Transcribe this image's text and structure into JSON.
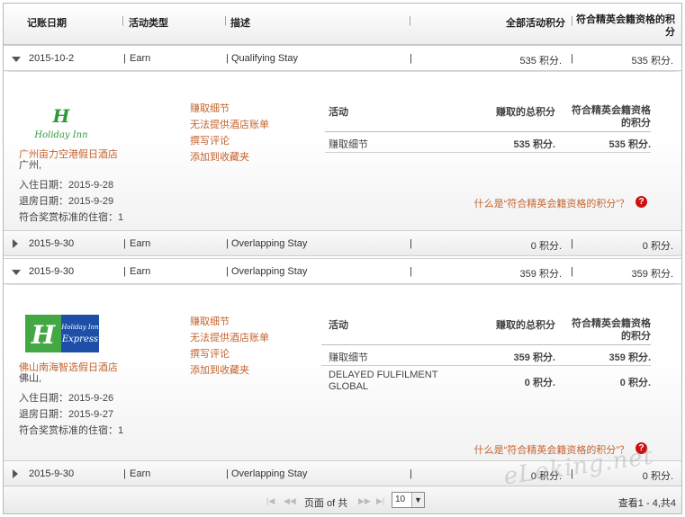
{
  "header": {
    "col_date": "记账日期",
    "col_type": "活动类型",
    "col_desc": "描述",
    "col_total": "全部活动积分",
    "col_elite_1": "符合精英会籍资格的积",
    "col_elite_2": "分"
  },
  "rows": [
    {
      "date": "2015-10-2",
      "type": "Earn",
      "desc": "Qualifying Stay",
      "total": "535 积分.",
      "elite": "535 积分."
    },
    {
      "date": "2015-9-30",
      "type": "Earn",
      "desc": "Overlapping Stay",
      "total": "0 积分.",
      "elite": "0 积分."
    },
    {
      "date": "2015-9-30",
      "type": "Earn",
      "desc": "Overlapping Stay",
      "total": "359 积分.",
      "elite": "359 积分."
    },
    {
      "date": "2015-9-30",
      "type": "Earn",
      "desc": "Overlapping Stay",
      "total": "0 积分.",
      "elite": "0 积分."
    }
  ],
  "details": [
    {
      "logo_line1": "Holiday Inn",
      "hotel_name": "广州亩力空港假日酒店",
      "city": "广州,",
      "checkin": "入住日期：2015-9-28",
      "checkout": "退房日期：2015-9-29",
      "nights": "符合奖赏标准的住宿：1",
      "links": [
        "赚取细节",
        "无法提供酒店账单",
        "撰写评论",
        "添加到收藏夹"
      ],
      "table_head": {
        "activity": "活动",
        "earned": "赚取的总积分",
        "elite_1": "符合精英会籍资格",
        "elite_2": "的积分"
      },
      "table_rows": [
        {
          "activity": "赚取细节",
          "activity_2": "",
          "earned": "535 积分.",
          "elite": "535 积分."
        }
      ],
      "question": "什么是“符合精英会籍资格的积分”？"
    },
    {
      "logo_line1": "Holiday Inn",
      "logo_line2": "Express",
      "hotel_name": "佛山南海智选假日酒店",
      "city": "佛山,",
      "checkin": "入住日期：2015-9-26",
      "checkout": "退房日期：2015-9-27",
      "nights": "符合奖赏标准的住宿：1",
      "links": [
        "赚取细节",
        "无法提供酒店账单",
        "撰写评论",
        "添加到收藏夹"
      ],
      "table_head": {
        "activity": "活动",
        "earned": "赚取的总积分",
        "elite_1": "符合精英会籍资格",
        "elite_2": "的积分"
      },
      "table_rows": [
        {
          "activity": "赚取细节",
          "activity_2": "",
          "earned": "359 积分.",
          "elite": "359 积分."
        },
        {
          "activity": "DELAYED FULFILMENT",
          "activity_2": "GLOBAL",
          "earned": "0 积分.",
          "elite": "0 积分."
        }
      ],
      "question": "什么是“符合精英会籍资格的积分”？"
    }
  ],
  "pager": {
    "page_label": "页面 of 共",
    "page_size": "10",
    "summary": "查看1 - 4,共4"
  },
  "watermark": "eLoking.net",
  "colors": {
    "link": "#c4632f",
    "help_icon": "#cc1111"
  }
}
